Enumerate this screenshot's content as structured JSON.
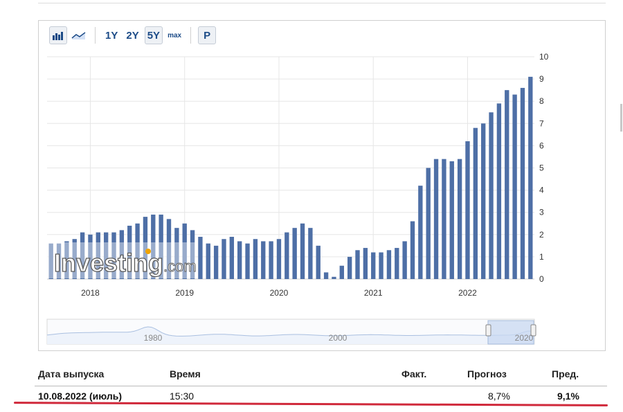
{
  "toolbar": {
    "bar_chart_icon": "bar-chart-icon",
    "line_chart_icon": "line-chart-icon",
    "range_1y": "1Y",
    "range_2y": "2Y",
    "range_5y": "5Y",
    "range_max": "max",
    "pin": "P",
    "active_range": "5Y"
  },
  "colors": {
    "bar": "#4e6fa6",
    "accent": "#1c4b87",
    "navigator_fill": "#c9d9f2",
    "red_underline": "#d0283a"
  },
  "watermark": {
    "brand": "Investing",
    "suffix": ".com"
  },
  "chart_data": {
    "type": "bar",
    "title": "",
    "xlabel": "",
    "ylabel": "",
    "ylim": [
      0,
      10
    ],
    "y_ticks": [
      0,
      1,
      2,
      3,
      4,
      5,
      6,
      7,
      8,
      9,
      10
    ],
    "x_tick_labels": [
      "2018",
      "2019",
      "2020",
      "2021",
      "2022"
    ],
    "grid": true,
    "categories": [
      "2017-08",
      "2017-09",
      "2017-10",
      "2017-11",
      "2017-12",
      "2018-01",
      "2018-02",
      "2018-03",
      "2018-04",
      "2018-05",
      "2018-06",
      "2018-07",
      "2018-08",
      "2018-09",
      "2018-10",
      "2018-11",
      "2018-12",
      "2019-01",
      "2019-02",
      "2019-03",
      "2019-04",
      "2019-05",
      "2019-06",
      "2019-07",
      "2019-08",
      "2019-09",
      "2019-10",
      "2019-11",
      "2019-12",
      "2020-01",
      "2020-02",
      "2020-03",
      "2020-04",
      "2020-05",
      "2020-06",
      "2020-07",
      "2020-08",
      "2020-09",
      "2020-10",
      "2020-11",
      "2020-12",
      "2021-01",
      "2021-02",
      "2021-03",
      "2021-04",
      "2021-05",
      "2021-06",
      "2021-07",
      "2021-08",
      "2021-09",
      "2021-10",
      "2021-11",
      "2021-12",
      "2022-01",
      "2022-02",
      "2022-03",
      "2022-04",
      "2022-05",
      "2022-06",
      "2022-07"
    ],
    "series": [
      {
        "values": [
          1.6,
          1.6,
          1.7,
          1.8,
          2.1,
          2.0,
          2.1,
          2.1,
          2.1,
          2.2,
          2.4,
          2.5,
          2.8,
          2.9,
          2.9,
          2.7,
          2.3,
          2.5,
          2.2,
          1.9,
          1.6,
          1.5,
          1.8,
          1.9,
          1.7,
          1.6,
          1.8,
          1.7,
          1.7,
          1.8,
          2.1,
          2.3,
          2.5,
          2.3,
          1.5,
          0.3,
          0.1,
          0.6,
          1.0,
          1.3,
          1.4,
          1.2,
          1.2,
          1.3,
          1.4,
          1.7,
          2.6,
          4.2,
          5.0,
          5.4,
          5.4,
          5.3,
          5.4,
          6.2,
          6.8,
          7.0,
          7.5,
          7.9,
          8.5,
          8.3,
          8.6,
          9.1
        ]
      }
    ],
    "navigator": {
      "labels": [
        "1980",
        "2000",
        "2020"
      ]
    }
  },
  "table": {
    "headers": {
      "date": "Дата выпуска",
      "time": "Время",
      "actual": "Факт.",
      "forecast": "Прогноз",
      "previous": "Пред."
    },
    "rows": [
      {
        "date": "10.08.2022 (июль)",
        "time": "15:30",
        "actual": "",
        "forecast": "8,7%",
        "previous": "9,1%"
      }
    ]
  }
}
